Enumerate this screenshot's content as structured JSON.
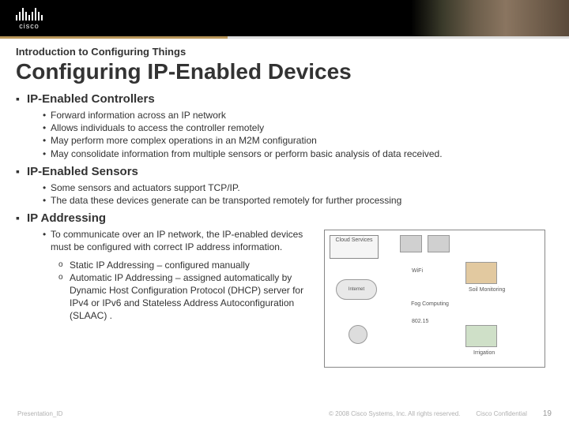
{
  "header": {
    "logo_text": "cisco"
  },
  "pretitle": "Introduction to Configuring Things",
  "title": "Configuring IP-Enabled Devices",
  "sections": [
    {
      "heading": "IP-Enabled Controllers",
      "bullets": [
        "Forward information across an IP network",
        "Allows individuals to access the controller remotely",
        "May perform more complex operations in an M2M configuration",
        "May consolidate information from multiple sensors or perform basic analysis of data received."
      ]
    },
    {
      "heading": "IP-Enabled Sensors",
      "bullets": [
        "Some sensors and actuators support TCP/IP.",
        "The data these devices generate can be transported remotely for further processing"
      ]
    },
    {
      "heading": "IP Addressing",
      "bullets": [
        "To communicate over an IP network, the IP-enabled devices must be configured with correct IP address information."
      ],
      "sub_bullets": [
        "Static IP Addressing – configured manually",
        "Automatic IP Addressing – assigned automatically by Dynamic Host Configuration Protocol (DHCP) server for IPv4 or IPv6  and Stateless Address Autoconfiguration (SLAAC) ."
      ]
    }
  ],
  "diagram": {
    "cloud_services": "Cloud Services",
    "internet": "Internet",
    "fog": "Fog Computing",
    "wifi": "WiFi",
    "eth": "802.15",
    "soil": "Soil Monitoring",
    "irrigation": "Irrigation"
  },
  "footer": {
    "left": "Presentation_ID",
    "copyright": "© 2008 Cisco Systems, Inc. All rights reserved.",
    "confidential": "Cisco Confidential",
    "page": "19"
  }
}
